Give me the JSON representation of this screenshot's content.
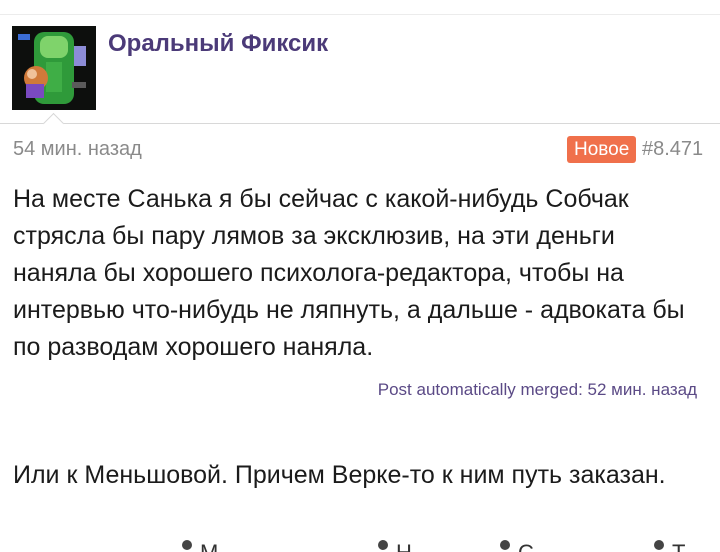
{
  "post": {
    "author": "Оральный Фиксик",
    "time": "54 мин. назад",
    "badge": "Новое",
    "number": "#8.471",
    "body": "На месте Санька я бы сейчас с какой-нибудь Собчак стрясла бы пару лямов за эксклюзив, на эти деньги наняла бы хорошего психолога-редактора, чтобы на интервью что-нибудь не ляпнуть, а дальше - адвоката бы по разводам хорошего наняла.",
    "merged_note": "Post automatically merged: 52 мин. назад",
    "body2": "Или к Меньшовой. Причем Верке-то к ним путь заказан."
  },
  "actions": [
    {
      "label": "М",
      "icon": "quote-icon"
    },
    {
      "label": "Н",
      "icon": "reply-icon"
    },
    {
      "label": "С",
      "icon": "share-icon"
    },
    {
      "label": "Т",
      "icon": "report-icon"
    }
  ],
  "colors": {
    "username": "#4b3a78",
    "badge_bg": "#f0704b",
    "meta": "#8a8a8a",
    "merged": "#5b4a86"
  }
}
